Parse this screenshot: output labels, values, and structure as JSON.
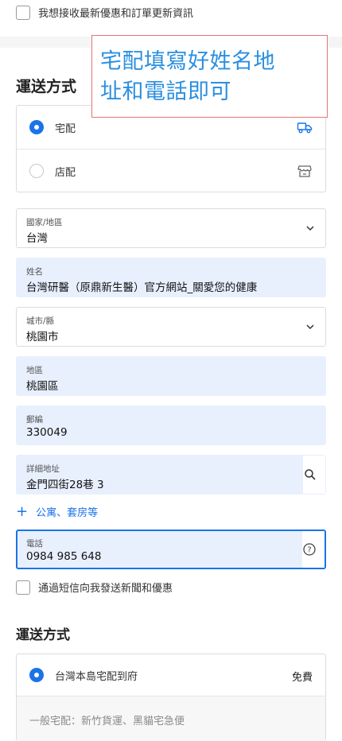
{
  "newsletter": {
    "label": "我想接收最新優惠和訂單更新資訊",
    "checked": false
  },
  "annotation": {
    "line1": "宅配填寫好姓名地",
    "line2": "址和電話即可"
  },
  "delivery_section": {
    "title": "運送方式",
    "options": [
      {
        "label": "宅配",
        "selected": true,
        "icon": "truck-icon"
      },
      {
        "label": "店配",
        "selected": false,
        "icon": "store-icon"
      }
    ]
  },
  "form": {
    "country": {
      "label": "國家/地區",
      "value": "台灣"
    },
    "name": {
      "label": "姓名",
      "value": "台灣研醫（原鼎新生醫）官方網站_關愛您的健康"
    },
    "city": {
      "label": "城市/縣",
      "value": "桃園市"
    },
    "district": {
      "label": "地區",
      "value": "桃園區"
    },
    "postal": {
      "label": "郵編",
      "value": "330049"
    },
    "address": {
      "label": "詳細地址",
      "value": "金門四街28巷 3"
    },
    "add_apartment": "公寓、套房等",
    "phone": {
      "label": "電話",
      "value": "0984 985 648"
    }
  },
  "sms_opt_in": {
    "label": "通過短信向我發送新聞和優惠",
    "checked": false
  },
  "shipping_method": {
    "title": "運送方式",
    "option_label": "台灣本島宅配到府",
    "price": "免費",
    "description": "一般宅配：新竹貨運、黑貓宅急便"
  },
  "colors": {
    "accent": "#1a73e8",
    "autofill": "#e8f0fe",
    "annotation_border": "#e57378",
    "annotation_text": "#2b8fe0"
  }
}
